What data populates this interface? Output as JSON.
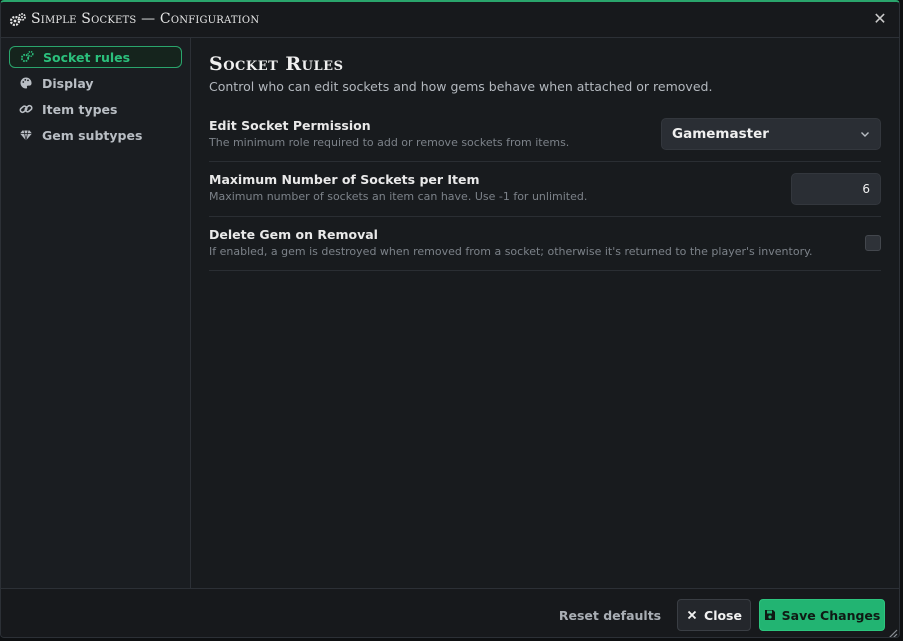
{
  "window": {
    "title": "Simple Sockets — Configuration",
    "close_glyph": "✕"
  },
  "sidebar": {
    "items": [
      {
        "label": "Socket rules",
        "icon": "gears-icon",
        "active": true
      },
      {
        "label": "Display",
        "icon": "palette-icon",
        "active": false
      },
      {
        "label": "Item types",
        "icon": "link-icon",
        "active": false
      },
      {
        "label": "Gem subtypes",
        "icon": "gem-icon",
        "active": false
      }
    ]
  },
  "main": {
    "title": "Socket Rules",
    "description": "Control who can edit sockets and how gems behave when attached or removed.",
    "settings": {
      "permission": {
        "label": "Edit Socket Permission",
        "hint": "The minimum role required to add or remove sockets from items.",
        "value": "Gamemaster"
      },
      "max_sockets": {
        "label": "Maximum Number of Sockets per Item",
        "hint": "Maximum number of sockets an item can have. Use -1 for unlimited.",
        "value": "6"
      },
      "delete_gem": {
        "label": "Delete Gem on Removal",
        "hint": "If enabled, a gem is destroyed when removed from a socket; otherwise it's returned to the player's inventory.",
        "checked": false
      }
    }
  },
  "footer": {
    "reset_label": "Reset defaults",
    "close_label": "Close",
    "save_label": "Save Changes"
  },
  "colors": {
    "accent": "#22b472",
    "background": "#1a1d21",
    "panel": "#181b1e"
  }
}
